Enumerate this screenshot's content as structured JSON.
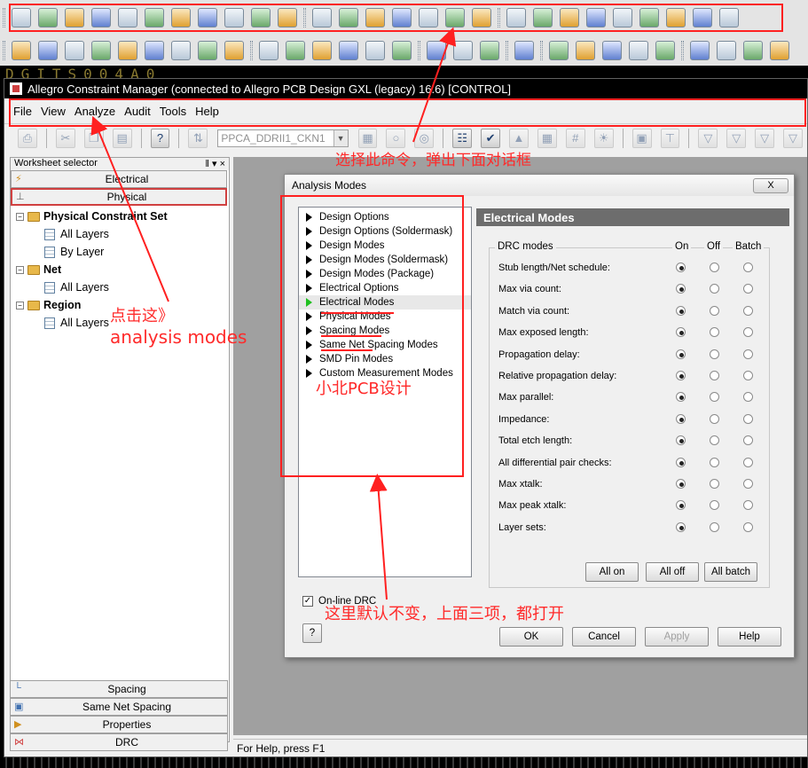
{
  "window": {
    "title": "Allegro Constraint Manager (connected to Allegro PCB Design GXL (legacy) 16.6) [CONTROL]"
  },
  "pcb_strip_text": "DGITS004A0",
  "menu": [
    "File",
    "View",
    "Analyze",
    "Audit",
    "Tools",
    "Help"
  ],
  "toolbar": {
    "net_combo_value": "PPCA_DDRII1_CKN1"
  },
  "worksheet": {
    "header": "Worksheet selector",
    "pin_glyph": "‖ ▾ ×",
    "tabs_top": [
      "Electrical",
      "Physical"
    ],
    "tree": [
      {
        "label": "Physical Constraint Set",
        "bold": true,
        "level": 0
      },
      {
        "label": "All Layers",
        "bold": false,
        "level": 1
      },
      {
        "label": "By Layer",
        "bold": false,
        "level": 1
      },
      {
        "label": "Net",
        "bold": true,
        "level": 0
      },
      {
        "label": "All Layers",
        "bold": false,
        "level": 1
      },
      {
        "label": "Region",
        "bold": true,
        "level": 0
      },
      {
        "label": "All Layers",
        "bold": false,
        "level": 1
      }
    ],
    "tabs_bottom": [
      "Spacing",
      "Same Net Spacing",
      "Properties",
      "DRC"
    ]
  },
  "status_bar": "For Help, press F1",
  "dialog": {
    "title": "Analysis Modes",
    "close": "X",
    "modes": [
      "Design Options",
      "Design Options (Soldermask)",
      "Design Modes",
      "Design Modes (Soldermask)",
      "Design Modes (Package)",
      "Electrical Options",
      "Electrical Modes",
      "Physical Modes",
      "Spacing Modes",
      "Same Net Spacing Modes",
      "SMD Pin Modes",
      "Custom Measurement Modes"
    ],
    "selected_mode": "Electrical Modes",
    "pane_title": "Electrical Modes",
    "group_label": "DRC modes",
    "col_on": "On",
    "col_off": "Off",
    "col_batch": "Batch",
    "drc_rows": [
      {
        "label": "Stub length/Net schedule:",
        "state": "on"
      },
      {
        "label": "Max via count:",
        "state": "on"
      },
      {
        "label": "Match via count:",
        "state": "on"
      },
      {
        "label": "Max exposed length:",
        "state": "on"
      },
      {
        "label": "Propagation delay:",
        "state": "on"
      },
      {
        "label": "Relative propagation delay:",
        "state": "on"
      },
      {
        "label": "Max parallel:",
        "state": "on"
      },
      {
        "label": "Impedance:",
        "state": "on"
      },
      {
        "label": "Total etch length:",
        "state": "on"
      },
      {
        "label": "All differential pair checks:",
        "state": "on"
      },
      {
        "label": "Max xtalk:",
        "state": "on"
      },
      {
        "label": "Max peak xtalk:",
        "state": "on"
      },
      {
        "label": "Layer sets:",
        "state": "on"
      }
    ],
    "btn_all_on": "All on",
    "btn_all_off": "All off",
    "btn_all_batch": "All batch",
    "online_drc_label": "On-line DRC",
    "online_drc_checked": true,
    "help_q": "?",
    "btn_ok": "OK",
    "btn_cancel": "Cancel",
    "btn_apply": "Apply",
    "btn_help": "Help"
  },
  "annotations": {
    "select_command": "选择此命令，弹出下面对话框",
    "click_here": "点击这》",
    "analysis_modes": "analysis modes",
    "brand": "小北PCB设计",
    "default_note": "这里默认不变，上面三项，都打开"
  },
  "colors": {
    "annotation_red": "#ff2020",
    "pane_title_bg": "#6d6d6d",
    "selected_marker": "#20c020"
  }
}
